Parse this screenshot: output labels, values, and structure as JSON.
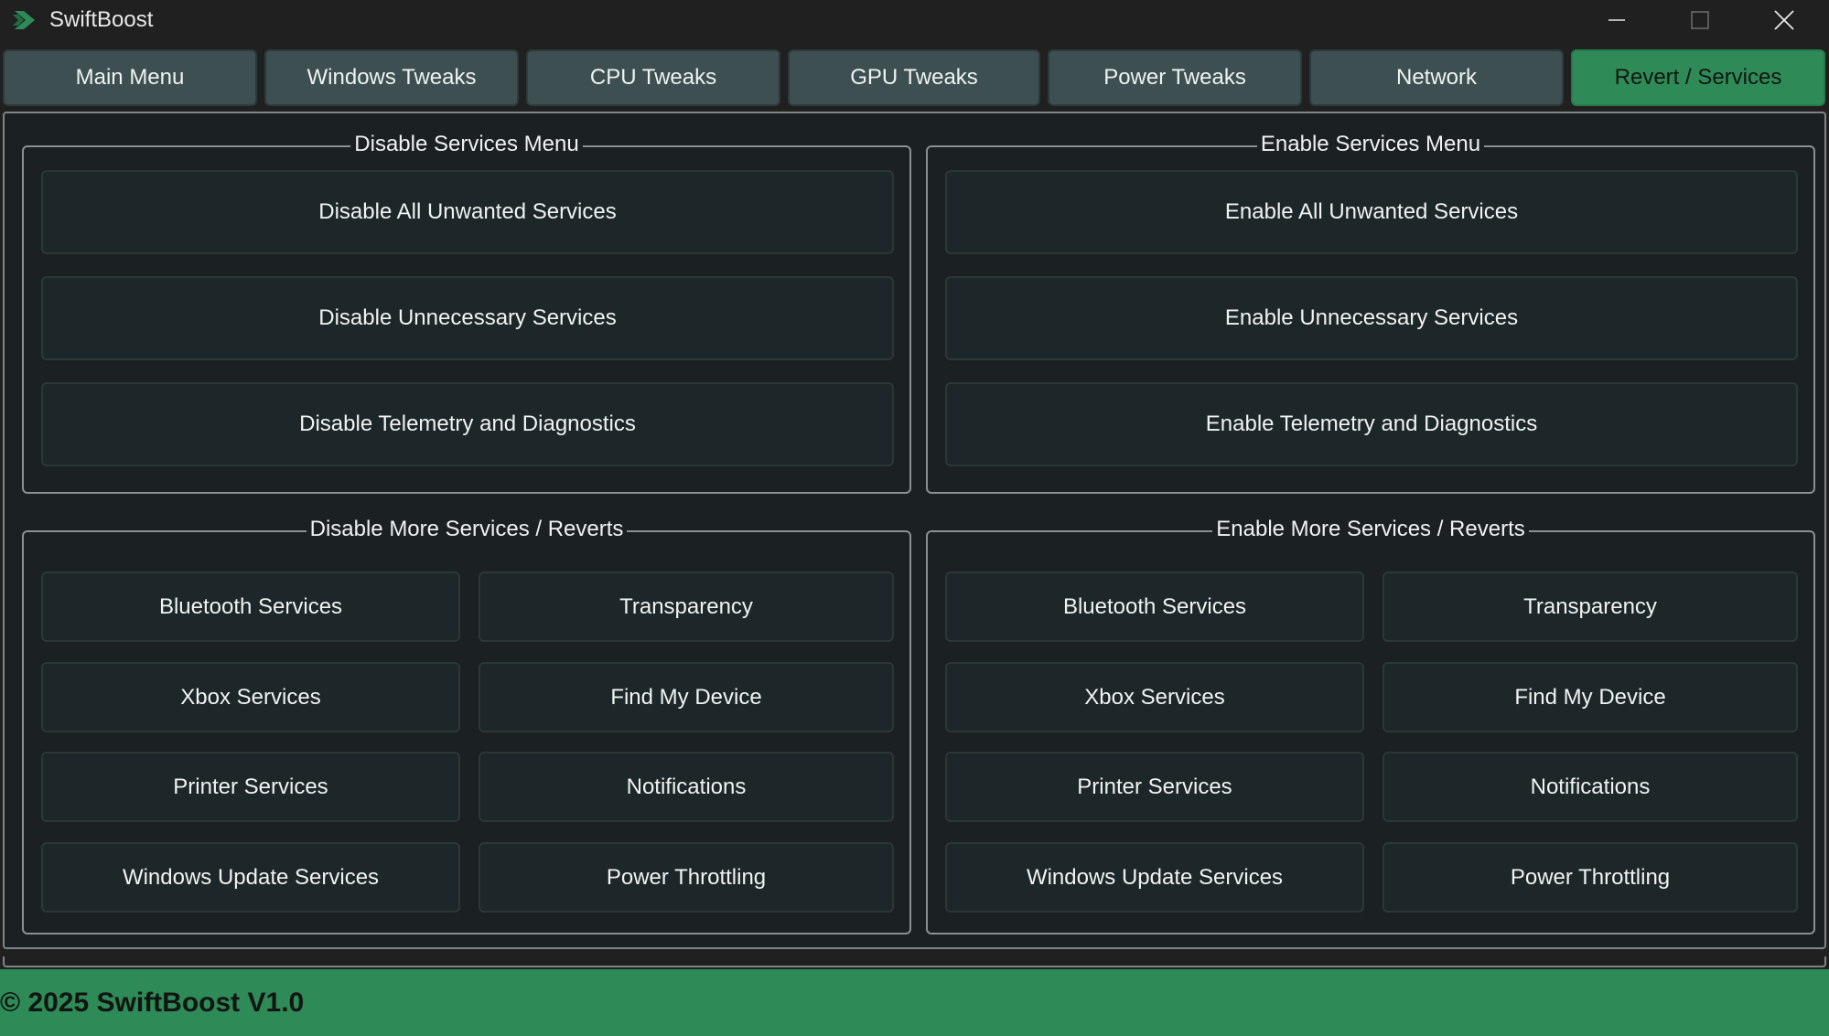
{
  "window": {
    "title": "SwiftBoost",
    "app_icon": "green-chevron-icon",
    "controls": [
      "minimize-icon",
      "maximize-icon",
      "close-icon"
    ]
  },
  "tabs": [
    {
      "label": "Main Menu",
      "active": false
    },
    {
      "label": "Windows Tweaks",
      "active": false
    },
    {
      "label": "CPU Tweaks",
      "active": false
    },
    {
      "label": "GPU Tweaks",
      "active": false
    },
    {
      "label": "Power Tweaks",
      "active": false
    },
    {
      "label": "Network",
      "active": false
    },
    {
      "label": "Revert / Services",
      "active": true
    }
  ],
  "disable_services": {
    "title": "Disable Services Menu",
    "buttons": [
      "Disable All Unwanted Services",
      "Disable Unnecessary Services",
      "Disable Telemetry and Diagnostics"
    ]
  },
  "enable_services": {
    "title": "Enable Services Menu",
    "buttons": [
      "Enable All Unwanted Services",
      "Enable Unnecessary Services",
      "Enable Telemetry and Diagnostics"
    ]
  },
  "disable_more": {
    "title": "Disable More Services / Reverts",
    "buttons": [
      "Bluetooth Services",
      "Transparency",
      "Xbox Services",
      "Find My Device",
      "Printer Services",
      "Notifications",
      "Windows Update Services",
      "Power Throttling"
    ]
  },
  "enable_more": {
    "title": "Enable More Services / Reverts",
    "buttons": [
      "Bluetooth Services",
      "Transparency",
      "Xbox Services",
      "Find My Device",
      "Printer Services",
      "Notifications",
      "Windows Update Services",
      "Power Throttling"
    ]
  },
  "footer": {
    "text": "© 2025 SwiftBoost V1.0"
  },
  "colors": {
    "accent": "#2e8b57",
    "tab_bg": "#3d4f50",
    "button_bg": "#1d2628",
    "window_bg": "#202020"
  }
}
